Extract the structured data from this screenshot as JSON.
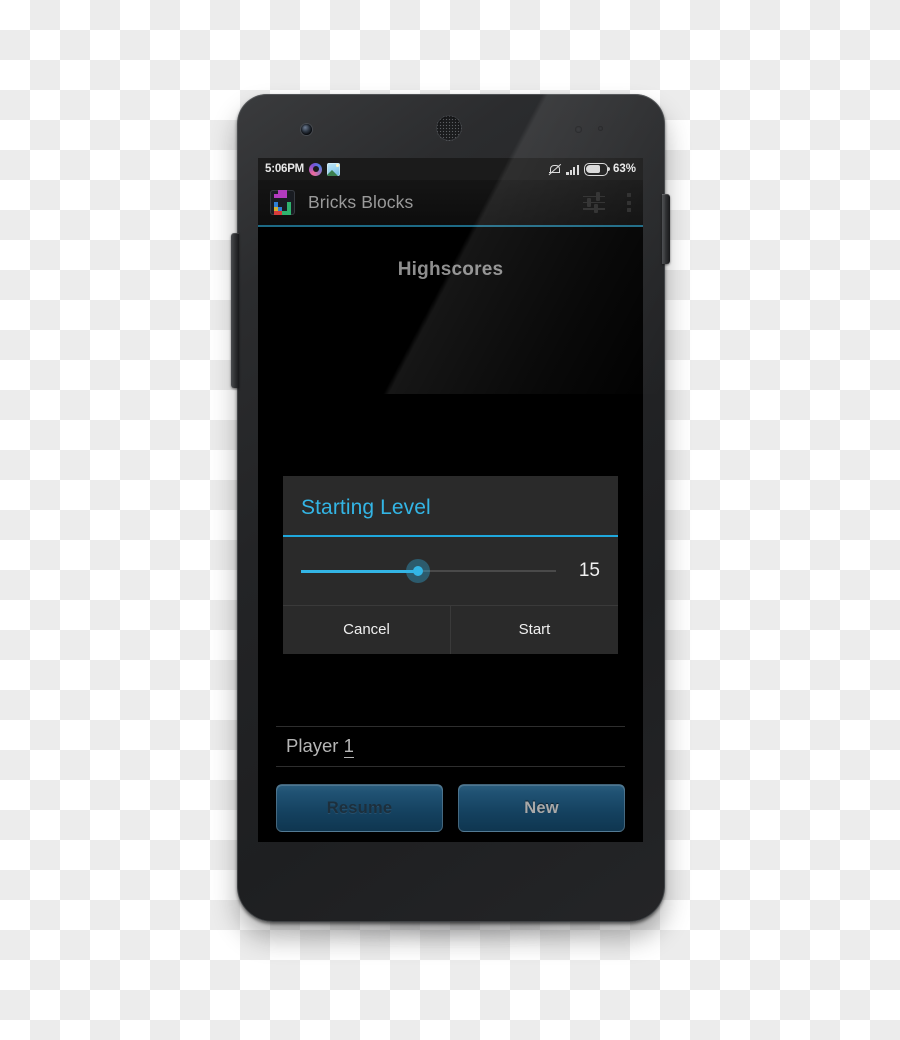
{
  "statusbar": {
    "clock": "5:06PM",
    "left_icons": [
      "chrome-icon",
      "photos-icon"
    ],
    "right_icons": [
      "mute-icon",
      "signal-icon",
      "battery-icon"
    ],
    "battery_percent": "63%",
    "battery_level": 63
  },
  "actionbar": {
    "app_icon": "bricks-blocks-app-icon",
    "title": "Bricks Blocks",
    "tune_icon": "tune-sliders-icon",
    "overflow_icon": "overflow-menu-icon"
  },
  "content": {
    "page_title": "Highscores"
  },
  "dialog": {
    "title": "Starting Level",
    "slider": {
      "value": "15",
      "value_number": 15,
      "percent": 46,
      "min": 1,
      "max": 30
    },
    "buttons": [
      {
        "label": "Cancel",
        "name": "cancel-button"
      },
      {
        "label": "Start",
        "name": "start-button"
      }
    ]
  },
  "bottom": {
    "player_name_prefix": "Player ",
    "player_name_suffix": "1",
    "player_name_full": "Player 1",
    "buttons": [
      {
        "label": "Resume",
        "name": "resume-button",
        "enabled": false
      },
      {
        "label": "New",
        "name": "new-button",
        "enabled": true
      }
    ]
  },
  "colors": {
    "accent_blue": "#33b5e5",
    "actionbar_divider": "#1d6a85",
    "dialog_bg": "#2a2a2a",
    "screen_bg": "#000000",
    "button_blue": "#205273",
    "title_gray": "#8e8e8e"
  }
}
